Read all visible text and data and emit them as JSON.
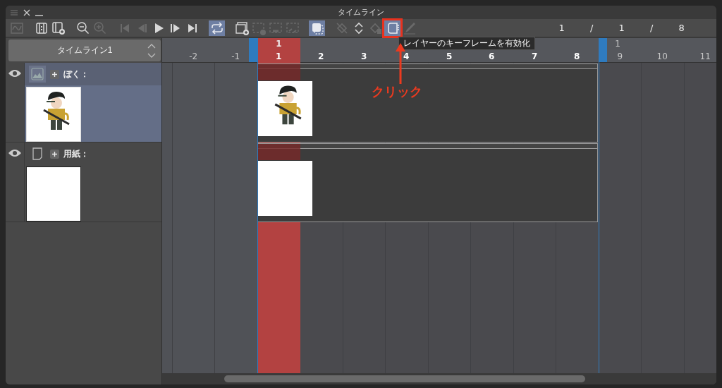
{
  "window": {
    "title": "タイムライン"
  },
  "toolbar": {
    "buttons": [
      {
        "kind": "graph",
        "on": false,
        "disabled": true
      },
      {
        "kind": "frames",
        "on": false,
        "disabled": false
      },
      {
        "kind": "add-frames",
        "on": false,
        "disabled": false
      },
      {
        "kind": "zoom-out",
        "on": false,
        "disabled": false
      },
      {
        "kind": "zoom-in",
        "on": false,
        "disabled": true
      },
      {
        "kind": "first",
        "on": false,
        "disabled": true
      },
      {
        "kind": "prev",
        "on": false,
        "disabled": true
      },
      {
        "kind": "play",
        "on": false,
        "disabled": false
      },
      {
        "kind": "next",
        "on": false,
        "disabled": false
      },
      {
        "kind": "last",
        "on": false,
        "disabled": false
      },
      {
        "kind": "loop",
        "on": true,
        "disabled": false
      },
      {
        "kind": "new-folder",
        "on": false,
        "disabled": false
      },
      {
        "kind": "new-cel",
        "on": false,
        "disabled": true
      },
      {
        "kind": "link-cel",
        "on": false,
        "disabled": true
      },
      {
        "kind": "unlink-cel",
        "on": false,
        "disabled": true
      },
      {
        "kind": "onion",
        "on": true,
        "disabled": false
      },
      {
        "kind": "move-key",
        "on": false,
        "disabled": true
      },
      {
        "kind": "spinner",
        "on": false,
        "disabled": false
      },
      {
        "kind": "delete-key",
        "on": false,
        "disabled": true
      },
      {
        "kind": "keyframe",
        "on": true,
        "disabled": false
      },
      {
        "kind": "pen",
        "on": false,
        "disabled": true
      }
    ],
    "counter": [
      "1",
      "/",
      "1",
      "/",
      "8"
    ]
  },
  "timeline_selector": {
    "value": "タイムライン1"
  },
  "ruler": {
    "ticks": [
      "-2",
      "-1",
      "1",
      "2",
      "3",
      "4",
      "5",
      "6",
      "7",
      "8",
      "9",
      "10",
      "11"
    ],
    "current_frame": "1",
    "end_label": "1"
  },
  "layers": [
    {
      "kind": "raster",
      "name": "ぼく：",
      "visible": true,
      "selected": true
    },
    {
      "kind": "paper",
      "name": "用紙：",
      "visible": true,
      "selected": false
    }
  ],
  "tooltip": "レイヤーのキーフレームを有効化",
  "annotation": {
    "label": "クリック"
  }
}
